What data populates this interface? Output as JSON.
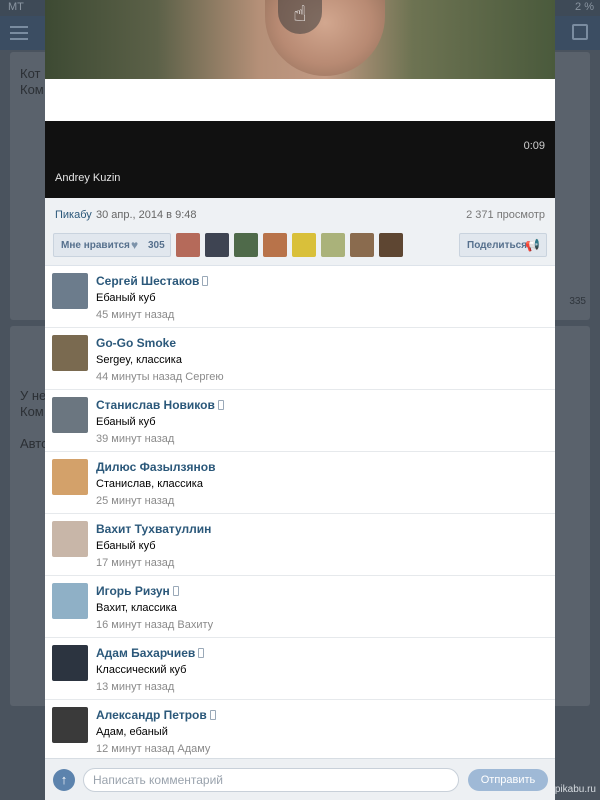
{
  "statusbar": {
    "carrier": "МТ",
    "battery": "2 %"
  },
  "background": {
    "post1_line1": "Кот",
    "post1_line2": "Ком",
    "post2_line1": "У не",
    "post2_line2": "Ком",
    "post2_line3": "Авто",
    "views_count": "335"
  },
  "video": {
    "duration": "0:09",
    "author": "Andrey Kuzin"
  },
  "meta": {
    "source": "Пикабу",
    "date": "30 апр., 2014 в 9:48",
    "views": "2 371 просмотр"
  },
  "likes": {
    "like_label": "Мне нравится",
    "like_count": "305",
    "share_label": "Поделиться",
    "liker_colors": [
      "#b56a5a",
      "#3e4452",
      "#4f6a4a",
      "#b8734a",
      "#d9c03a",
      "#aab27a",
      "#8a6b4e",
      "#5e4632"
    ]
  },
  "comments": [
    {
      "name": "Сергей Шестаков",
      "mobile": true,
      "text": "Ебаный куб",
      "time": "45 минут назад",
      "avatar_color": "#6c7c8c"
    },
    {
      "name": "Go-Go Smoke",
      "mobile": false,
      "text": "Sergey, классика",
      "time": "44 минуты назад Сергею",
      "avatar_color": "#7a6a50"
    },
    {
      "name": "Станислав Новиков",
      "mobile": true,
      "text": "Ебаный куб",
      "time": "39 минут назад",
      "avatar_color": "#6b7680"
    },
    {
      "name": "Дилюс Фазылзянов",
      "mobile": false,
      "text": "Станислав, классика",
      "time": "25 минут назад",
      "avatar_color": "#d3a16a"
    },
    {
      "name": "Вахит Тухватуллин",
      "mobile": false,
      "text": "Ебаный куб",
      "time": "17 минут назад",
      "avatar_color": "#c8b6a8"
    },
    {
      "name": "Игорь Ризун",
      "mobile": true,
      "text": "Вахит, классика",
      "time": "16 минут назад Вахиту",
      "avatar_color": "#8fb0c6"
    },
    {
      "name": "Адам Бахарчиев",
      "mobile": true,
      "text": "Классический куб",
      "time": "13 минут назад",
      "avatar_color": "#2c3440"
    },
    {
      "name": "Александр Петров",
      "mobile": true,
      "text": "Адам, ебаный",
      "time": "12 минут назад Адаму",
      "avatar_color": "#3a3a3a"
    }
  ],
  "input": {
    "placeholder": "Написать комментарий",
    "value": "",
    "send_label": "Отправить"
  },
  "watermark": "pikabu.ru"
}
